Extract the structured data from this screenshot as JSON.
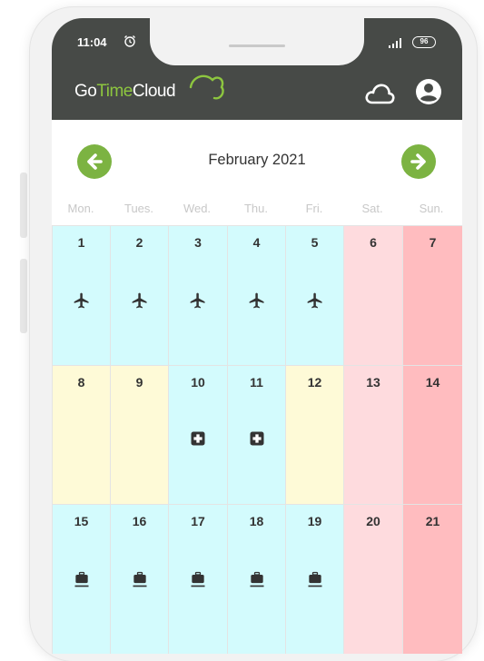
{
  "status_bar": {
    "time": "11:04",
    "battery": "96",
    "alarm_icon": "alarm-icon",
    "signal_icon": "signal-icon"
  },
  "app": {
    "logo_parts": [
      "Go",
      "Time",
      "Cloud"
    ],
    "cloud_icon": "cloud-icon",
    "profile_icon": "account-circle-icon",
    "brand_color": "#7cb342",
    "appbar_color": "#474a47"
  },
  "calendar": {
    "month_title": "February 2021",
    "prev_icon": "arrow-left-icon",
    "next_icon": "arrow-right-icon",
    "weekdays": [
      "Mon.",
      "Tues.",
      "Wed.",
      "Thu.",
      "Fri.",
      "Sat.",
      "Sun."
    ],
    "legend_colors": {
      "work": "#d3fbfd",
      "leave": "#fefad7",
      "saturday": "#fedbde",
      "sunday": "#ffbcbf"
    },
    "weeks": [
      [
        {
          "day": "1",
          "type": "work",
          "icon": "airplane-icon"
        },
        {
          "day": "2",
          "type": "work",
          "icon": "airplane-icon"
        },
        {
          "day": "3",
          "type": "work",
          "icon": "airplane-icon"
        },
        {
          "day": "4",
          "type": "work",
          "icon": "airplane-icon"
        },
        {
          "day": "5",
          "type": "work",
          "icon": "airplane-icon"
        },
        {
          "day": "6",
          "type": "sat",
          "icon": ""
        },
        {
          "day": "7",
          "type": "sun",
          "icon": ""
        }
      ],
      [
        {
          "day": "8",
          "type": "leave",
          "icon": ""
        },
        {
          "day": "9",
          "type": "leave",
          "icon": ""
        },
        {
          "day": "10",
          "type": "work",
          "icon": "medical-plus-icon"
        },
        {
          "day": "11",
          "type": "work",
          "icon": "medical-plus-icon"
        },
        {
          "day": "12",
          "type": "leave",
          "icon": ""
        },
        {
          "day": "13",
          "type": "sat",
          "icon": ""
        },
        {
          "day": "14",
          "type": "sun",
          "icon": ""
        }
      ],
      [
        {
          "day": "15",
          "type": "work",
          "icon": "briefcase-icon"
        },
        {
          "day": "16",
          "type": "work",
          "icon": "briefcase-icon"
        },
        {
          "day": "17",
          "type": "work",
          "icon": "briefcase-icon"
        },
        {
          "day": "18",
          "type": "work",
          "icon": "briefcase-icon"
        },
        {
          "day": "19",
          "type": "work",
          "icon": "briefcase-icon"
        },
        {
          "day": "20",
          "type": "sat",
          "icon": ""
        },
        {
          "day": "21",
          "type": "sun",
          "icon": ""
        }
      ]
    ]
  }
}
